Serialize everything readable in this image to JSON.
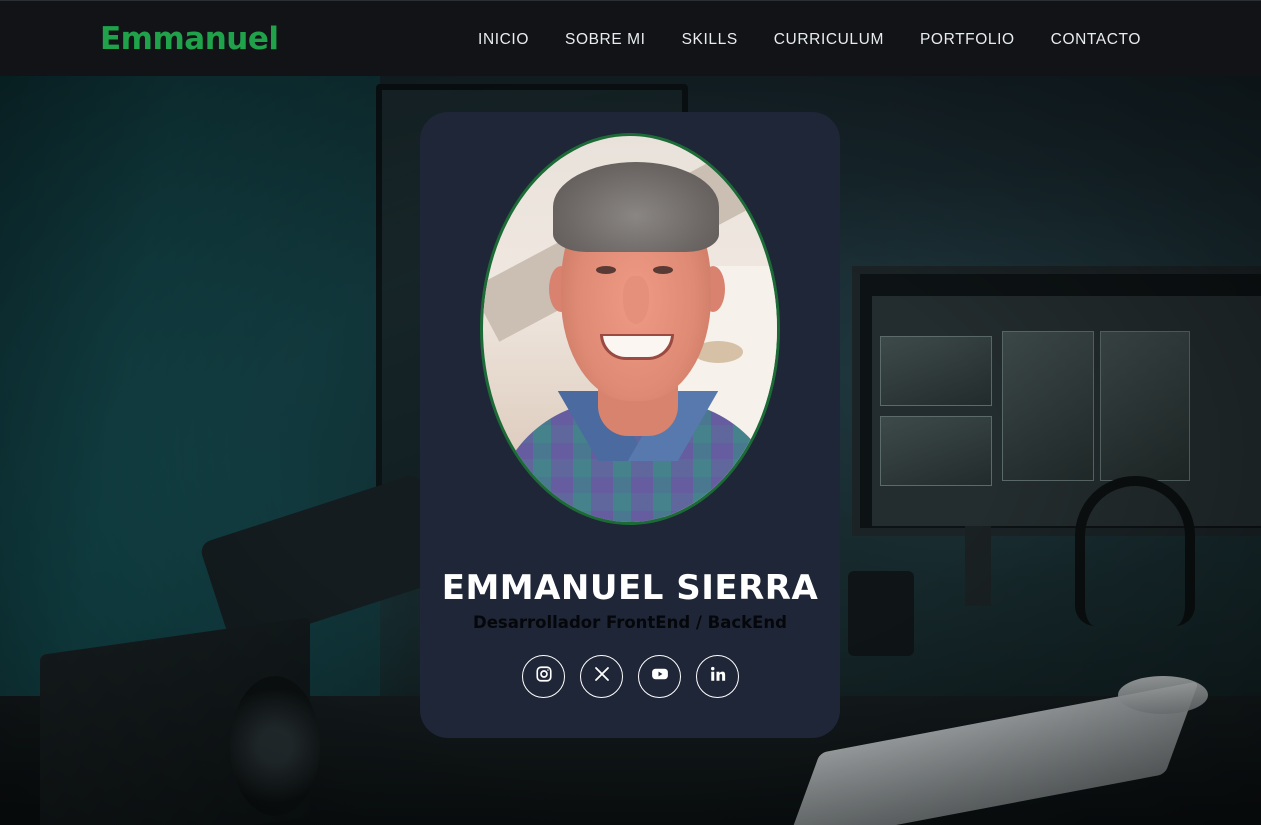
{
  "header": {
    "brand": "Emmanuel",
    "nav": [
      {
        "label": "INICIO"
      },
      {
        "label": "SOBRE MI"
      },
      {
        "label": "SKILLS"
      },
      {
        "label": "CURRICULUM"
      },
      {
        "label": "PORTFOLIO"
      },
      {
        "label": "CONTACTO"
      }
    ]
  },
  "profile": {
    "name": "EMMANUEL SIERRA",
    "role": "Desarrollador FrontEnd / BackEnd",
    "photo_alt": "Emmanuel Sierra portrait",
    "socials": [
      {
        "icon": "instagram-icon"
      },
      {
        "icon": "x-twitter-icon"
      },
      {
        "icon": "youtube-icon"
      },
      {
        "icon": "linkedin-icon"
      }
    ]
  },
  "colors": {
    "brand": "#1fa24a",
    "header_bg": "#111317",
    "card_bg": "#1f2637",
    "photo_border": "#1c6b37",
    "role_text": "#05070a"
  }
}
